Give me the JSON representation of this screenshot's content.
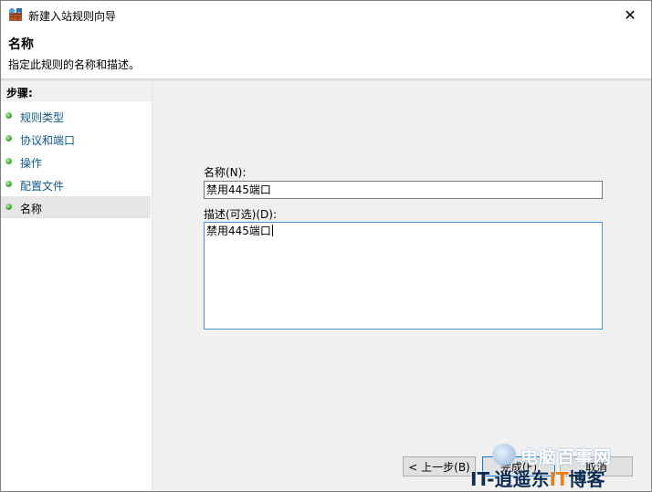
{
  "window": {
    "title": "新建入站规则向导",
    "close_glyph": "✕"
  },
  "header": {
    "title": "名称",
    "description": "指定此规则的名称和描述。"
  },
  "sidebar": {
    "steps_label": "步骤:",
    "steps": [
      {
        "label": "规则类型",
        "active": false
      },
      {
        "label": "协议和端口",
        "active": false
      },
      {
        "label": "操作",
        "active": false
      },
      {
        "label": "配置文件",
        "active": false
      },
      {
        "label": "名称",
        "active": true
      }
    ]
  },
  "form": {
    "name_label": "名称(N):",
    "name_value": "禁用445端口",
    "desc_label": "描述(可选)(D):",
    "desc_value": "禁用445端口"
  },
  "buttons": {
    "back": "< 上一步(B)",
    "next": "完成(F)",
    "cancel": "取消"
  },
  "watermark": {
    "line1": "电脑百事网",
    "line2_prefix": "IT-逍遥东",
    "line2_orange": "IT",
    "line2_suffix": "博客"
  }
}
